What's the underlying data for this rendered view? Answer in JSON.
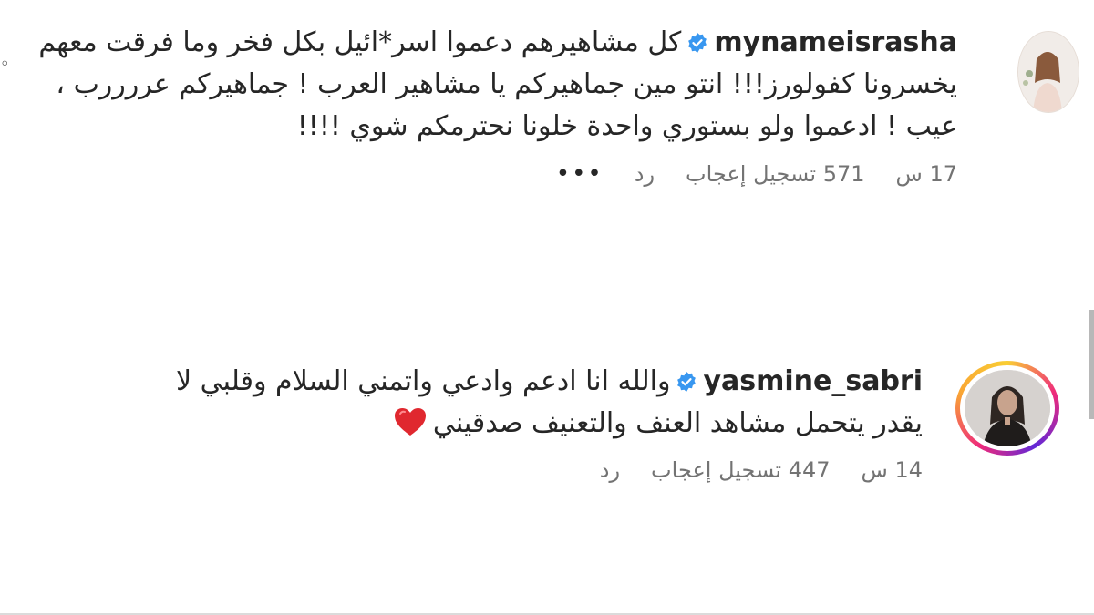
{
  "comments": [
    {
      "username": "mynameisrasha",
      "verified": true,
      "text": "كل مشاهيرهم دعموا اسر*ائيل بكل فخر وما فرقت معهم يخسرونا كفولورز!!! انتو مين جماهيركم يا مشاهير العرب ! جماهيركم عررررب ، عيب ! ادعموا ولو بستوري واحدة خلونا نحترمكم شوي !!!!",
      "time": "17 س",
      "likes": "571 تسجيل إعجاب",
      "reply": "رد",
      "more": "•••"
    },
    {
      "username": "yasmine_sabri",
      "verified": true,
      "text": "والله انا ادعم وادعي واتمني السلام وقلبي لا يقدر يتحمل مشاهد العنف والتعنيف صدقيني",
      "time": "14 س",
      "likes": "447 تسجيل إعجاب",
      "reply": "رد"
    }
  ],
  "colors": {
    "verified": "#3897f0",
    "heart": "#e0282f",
    "meta": "#737373"
  }
}
